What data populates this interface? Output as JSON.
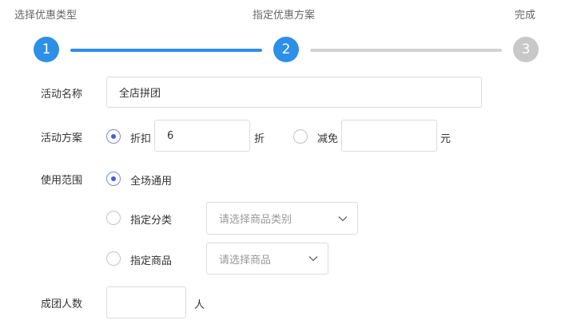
{
  "steps": [
    {
      "title": "选择优惠类型",
      "number": "1",
      "state": "done"
    },
    {
      "title": "指定优惠方案",
      "number": "2",
      "state": "current"
    },
    {
      "title": "完成",
      "number": "3",
      "state": "pending"
    }
  ],
  "form": {
    "name": {
      "label": "活动名称",
      "value": "全店拼团"
    },
    "plan": {
      "label": "活动方案",
      "discount": {
        "label": "折扣",
        "value": "6",
        "unit": "折",
        "checked": true
      },
      "reduce": {
        "label": "减免",
        "value": "",
        "unit": "元",
        "checked": false
      }
    },
    "scope": {
      "label": "使用范围",
      "all": {
        "label": "全场通用",
        "checked": true
      },
      "category": {
        "label": "指定分类",
        "placeholder": "请选择商品类别",
        "checked": false
      },
      "product": {
        "label": "指定商品",
        "placeholder": "请选择商品",
        "checked": false
      }
    },
    "group_size": {
      "label": "成团人数",
      "value": "",
      "unit": "人"
    }
  },
  "colors": {
    "accent": "#2d8fe6",
    "inactive": "#c8c8c8",
    "radio": "#4a5fc9"
  }
}
